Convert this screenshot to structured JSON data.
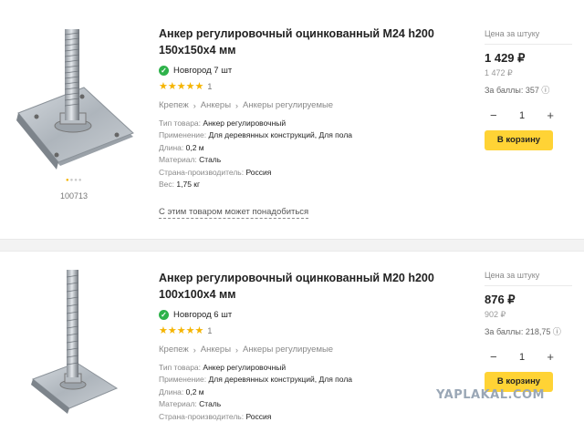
{
  "products": [
    {
      "title_line1": "Анкер регулировочный оцинкованный М24 h200",
      "title_line2": "150х150х4 мм",
      "stock": "Новгород 7 шт",
      "rating_count": "1",
      "breadcrumbs": [
        "Крепеж",
        "Анкеры",
        "Анкеры регулируемые"
      ],
      "props": [
        {
          "key": "Тип товара:",
          "value": "Анкер регулировочный"
        },
        {
          "key": "Применение:",
          "value": "Для деревянных конструкций, Для пола"
        },
        {
          "key": "Длина:",
          "value": "0,2 м"
        },
        {
          "key": "Материал:",
          "value": "Сталь"
        },
        {
          "key": "Страна-производитель:",
          "value": "Россия"
        },
        {
          "key": "Вес:",
          "value": "1,75 кг"
        }
      ],
      "sku": "100713",
      "price_label": "Цена за штуку",
      "price": "1 429 ₽",
      "old_price": "1 472 ₽",
      "bonus": "За баллы: 357 ⓘ",
      "qty": "1",
      "qty_minus": "−",
      "qty_plus": "+",
      "cart_label": "В корзину",
      "more_link": "С этим товаром может понадобиться"
    },
    {
      "title_line1": "Анкер регулировочный оцинкованный М20 h200",
      "title_line2": "100х100х4 мм",
      "stock": "Новгород 6 шт",
      "rating_count": "1",
      "breadcrumbs": [
        "Крепеж",
        "Анкеры",
        "Анкеры регулируемые"
      ],
      "props": [
        {
          "key": "Тип товара:",
          "value": "Анкер регулировочный"
        },
        {
          "key": "Применение:",
          "value": "Для деревянных конструкций, Для пола"
        },
        {
          "key": "Длина:",
          "value": "0,2 м"
        },
        {
          "key": "Материал:",
          "value": "Сталь"
        },
        {
          "key": "Страна-производитель:",
          "value": "Россия"
        }
      ],
      "price_label": "Цена за штуку",
      "price": "876 ₽",
      "old_price": "902 ₽",
      "bonus": "За баллы: 218,75 ⓘ",
      "qty": "1",
      "qty_minus": "−",
      "qty_plus": "+",
      "cart_label": "В корзину"
    }
  ],
  "stars": "★★★★★",
  "breadcrumb_sep": "›",
  "check_glyph": "✓",
  "watermark": "YAPLAKAL.COM",
  "colors": {
    "accent_button": "#ffd335",
    "stock_check": "#2eb24a",
    "star": "#f5b400"
  }
}
